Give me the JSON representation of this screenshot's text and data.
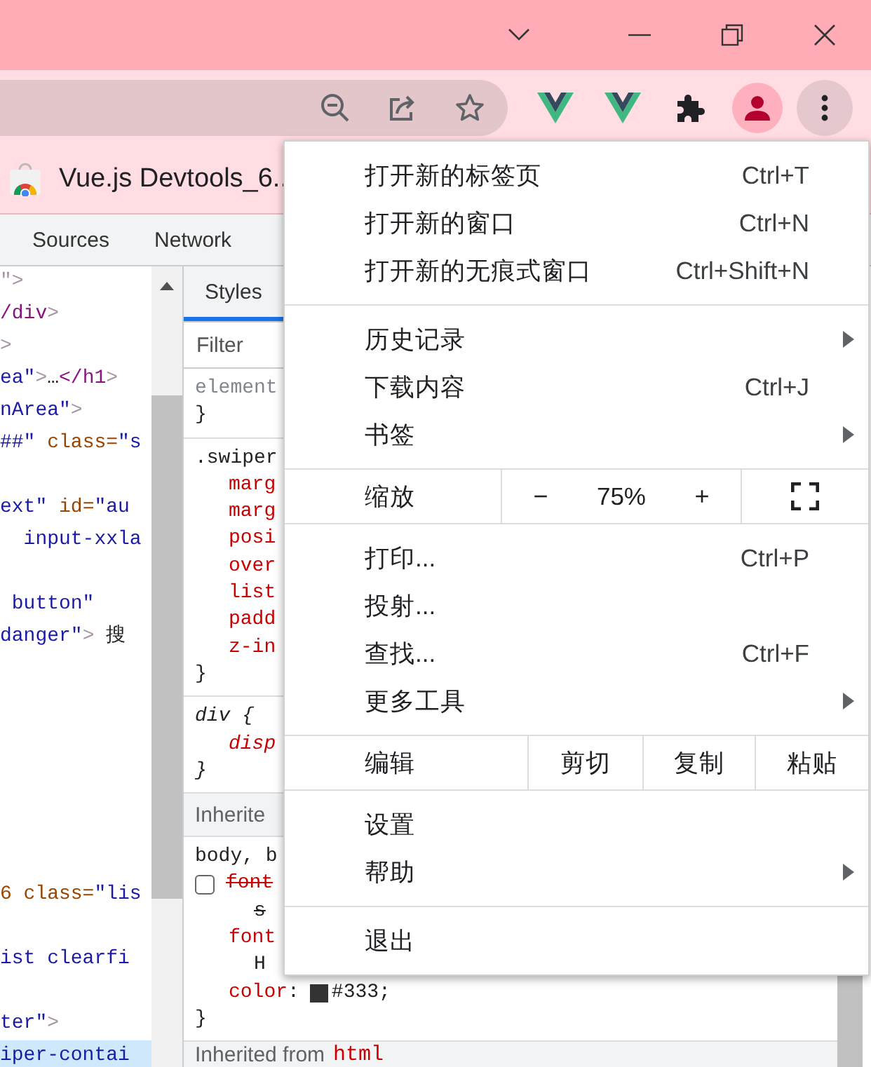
{
  "bookmarks_bar": {
    "items": [
      {
        "label": "Vue.js Devtools_6.."
      }
    ]
  },
  "devtools": {
    "tabs": [
      {
        "label": "Sources",
        "selected": false
      },
      {
        "label": "Network",
        "selected": false
      }
    ],
    "elements": {
      "lines": [
        {
          "kind": "code",
          "selected": false,
          "parts": [
            {
              "kind": "punct",
              "text": "\">"
            }
          ]
        },
        {
          "kind": "code",
          "selected": false,
          "parts": [
            {
              "kind": "tag",
              "text": "/div"
            },
            {
              "kind": "punct",
              "text": ">"
            }
          ]
        },
        {
          "kind": "code",
          "selected": false,
          "parts": [
            {
              "kind": "punct",
              "text": ">"
            }
          ]
        },
        {
          "kind": "code",
          "selected": false,
          "parts": [
            {
              "kind": "val",
              "text": "ea\""
            },
            {
              "kind": "punct",
              "text": ">"
            },
            {
              "kind": "text",
              "text": "…"
            },
            {
              "kind": "tag",
              "text": "</h1"
            },
            {
              "kind": "punct",
              "text": ">"
            }
          ]
        },
        {
          "kind": "code",
          "selected": false,
          "parts": [
            {
              "kind": "val",
              "text": "nArea\""
            },
            {
              "kind": "punct",
              "text": ">"
            }
          ]
        },
        {
          "kind": "code",
          "selected": false,
          "parts": [
            {
              "kind": "val",
              "text": "##\""
            },
            {
              "kind": "attr",
              "text": " class="
            },
            {
              "kind": "val",
              "text": "\"s"
            }
          ]
        },
        {
          "kind": "blank"
        },
        {
          "kind": "code",
          "selected": false,
          "parts": [
            {
              "kind": "val",
              "text": "ext\""
            },
            {
              "kind": "attr",
              "text": " id="
            },
            {
              "kind": "val",
              "text": "\"au"
            }
          ]
        },
        {
          "kind": "code",
          "selected": false,
          "parts": [
            {
              "kind": "val",
              "text": "  input-xxla"
            }
          ]
        },
        {
          "kind": "blank"
        },
        {
          "kind": "code",
          "selected": false,
          "parts": [
            {
              "kind": "val",
              "text": " button\""
            }
          ]
        },
        {
          "kind": "code",
          "selected": false,
          "parts": [
            {
              "kind": "val",
              "text": "danger\""
            },
            {
              "kind": "punct",
              "text": ">"
            },
            {
              "kind": "text",
              "text": " 搜"
            }
          ]
        },
        {
          "kind": "blank"
        },
        {
          "kind": "blank"
        },
        {
          "kind": "blank"
        },
        {
          "kind": "blank"
        },
        {
          "kind": "blank"
        },
        {
          "kind": "blank"
        },
        {
          "kind": "blank"
        },
        {
          "kind": "code",
          "selected": false,
          "parts": [
            {
              "kind": "attr",
              "text": "6 class="
            },
            {
              "kind": "val",
              "text": "\"lis"
            }
          ]
        },
        {
          "kind": "blank"
        },
        {
          "kind": "code",
          "selected": false,
          "parts": [
            {
              "kind": "val",
              "text": "ist clearfi"
            }
          ]
        },
        {
          "kind": "blank"
        },
        {
          "kind": "code",
          "selected": false,
          "parts": [
            {
              "kind": "val",
              "text": "ter\""
            },
            {
              "kind": "punct",
              "text": ">"
            }
          ]
        },
        {
          "kind": "code",
          "selected": true,
          "parts": [
            {
              "kind": "val",
              "text": "iper-contai"
            }
          ]
        }
      ]
    },
    "styles": {
      "tabs": [
        {
          "label": "Styles",
          "selected": true
        }
      ],
      "filter": {
        "placeholder": "Filter"
      },
      "blocks": [
        {
          "kind": "rule",
          "italic": false,
          "lines": [
            {
              "kind": "muted",
              "text": "element"
            },
            {
              "kind": "brace",
              "text": "}"
            }
          ]
        },
        {
          "kind": "rule",
          "italic": false,
          "lines": [
            {
              "kind": "selector",
              "text": ".swiper"
            },
            {
              "kind": "prop",
              "text": "marg"
            },
            {
              "kind": "prop",
              "text": "marg"
            },
            {
              "kind": "prop",
              "text": "posi"
            },
            {
              "kind": "prop",
              "text": "over"
            },
            {
              "kind": "prop",
              "text": "list"
            },
            {
              "kind": "prop",
              "text": "padd"
            },
            {
              "kind": "prop",
              "text": "z-in"
            },
            {
              "kind": "brace",
              "text": "}"
            }
          ]
        },
        {
          "kind": "rule",
          "italic": true,
          "lines": [
            {
              "kind": "selector",
              "text": "div {"
            },
            {
              "kind": "prop",
              "text": "disp"
            },
            {
              "kind": "brace",
              "text": "}"
            }
          ]
        },
        {
          "kind": "header",
          "text": "Inherite"
        },
        {
          "kind": "rule",
          "italic": false,
          "lines": [
            {
              "kind": "selector",
              "text": "body, b"
            },
            {
              "kind": "prop",
              "text": "font",
              "overridden": true,
              "checked": false
            },
            {
              "kind": "value",
              "text": "s",
              "overridden": true
            },
            {
              "kind": "prop",
              "text": "font"
            },
            {
              "kind": "value",
              "text": "H"
            },
            {
              "kind": "decl",
              "prop": "color",
              "sep": ":",
              "value": "#333;",
              "color": "#333333"
            },
            {
              "kind": "brace",
              "text": "}"
            }
          ]
        }
      ],
      "footer": {
        "label": "Inherited from",
        "tag": "html"
      }
    }
  },
  "menu": {
    "sections": [
      {
        "kind": "commands",
        "items": [
          {
            "label": "打开新的标签页",
            "shortcut": "Ctrl+T",
            "submenu": false
          },
          {
            "label": "打开新的窗口",
            "shortcut": "Ctrl+N",
            "submenu": false
          },
          {
            "label": "打开新的无痕式窗口",
            "shortcut": "Ctrl+Shift+N",
            "submenu": false
          }
        ]
      },
      {
        "kind": "commands",
        "items": [
          {
            "label": "历史记录",
            "submenu": true
          },
          {
            "label": "下载内容",
            "shortcut": "Ctrl+J",
            "submenu": false
          },
          {
            "label": "书签",
            "submenu": true
          }
        ]
      },
      {
        "kind": "zoom",
        "label": "缩放",
        "minus": "−",
        "value": "75%",
        "plus": "+"
      },
      {
        "kind": "commands",
        "items": [
          {
            "label": "打印...",
            "shortcut": "Ctrl+P",
            "submenu": false
          },
          {
            "label": "投射...",
            "submenu": false
          },
          {
            "label": "查找...",
            "shortcut": "Ctrl+F",
            "submenu": false
          },
          {
            "label": "更多工具",
            "submenu": true
          }
        ]
      },
      {
        "kind": "edit",
        "label": "编辑",
        "actions": [
          "剪切",
          "复制",
          "粘贴"
        ]
      },
      {
        "kind": "commands",
        "items": [
          {
            "label": "设置",
            "submenu": false
          },
          {
            "label": "帮助",
            "submenu": true
          }
        ]
      },
      {
        "kind": "commands",
        "items": [
          {
            "label": "退出",
            "submenu": false
          }
        ]
      }
    ]
  }
}
